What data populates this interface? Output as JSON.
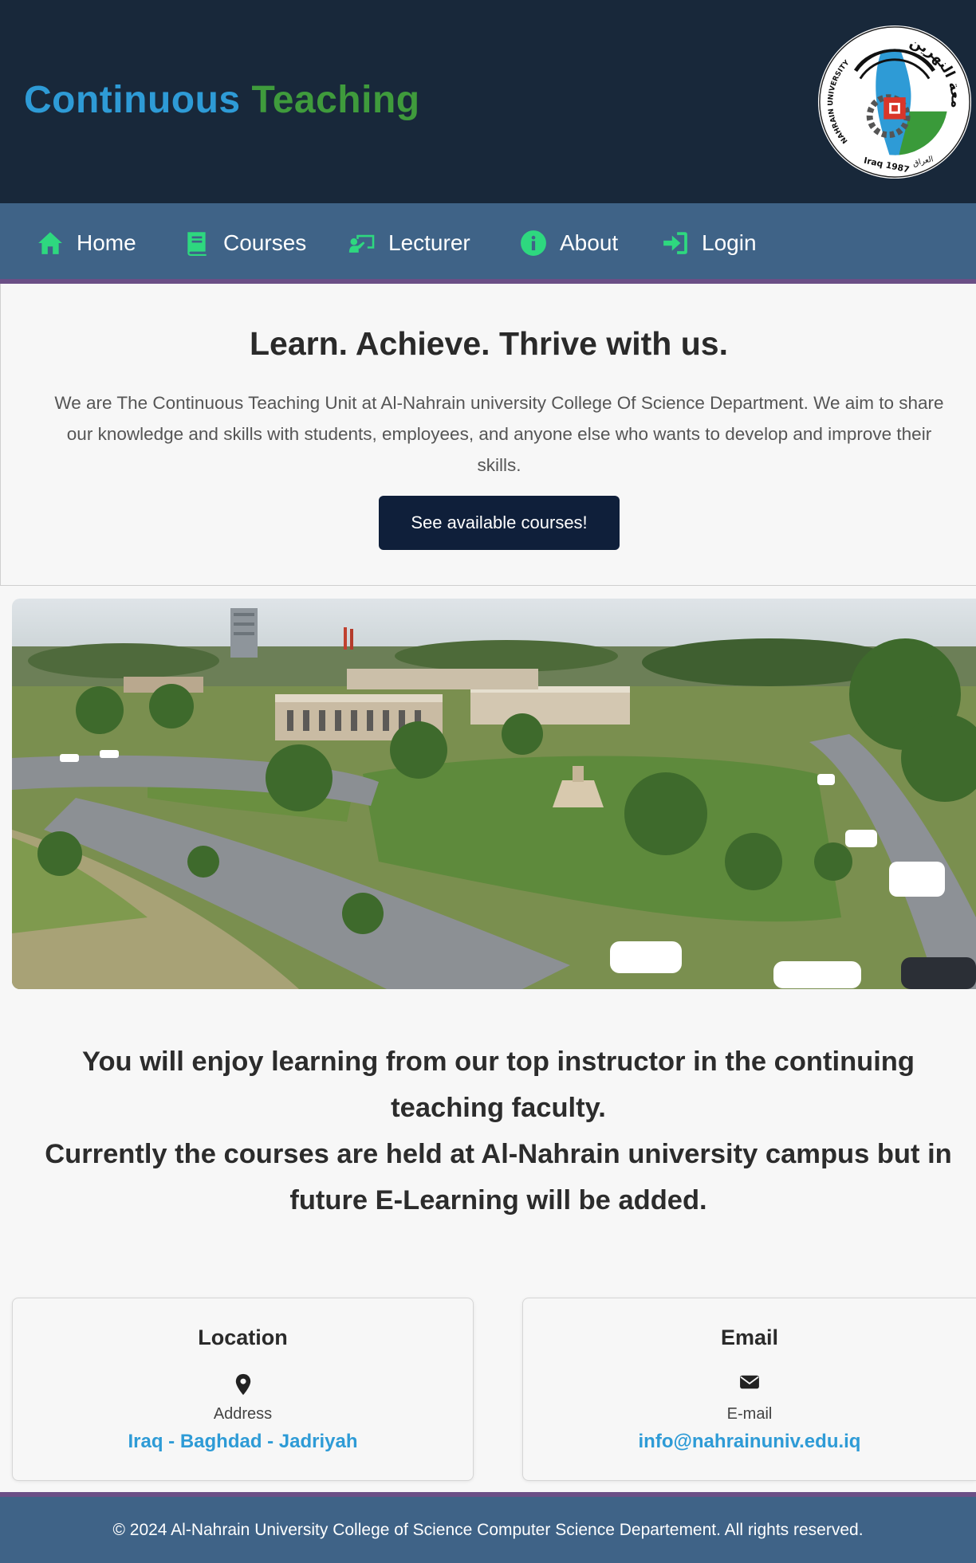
{
  "brand": {
    "word1": "Continuous",
    "word2": "Teaching",
    "colors": {
      "word1": "#2e9bd6",
      "word2": "#3f9b3c"
    }
  },
  "logo": {
    "text_top": "NAHRAIN UNIVERSITY",
    "text_arabic": "جامعة النهرين",
    "text_bottom_left": "Iraq 1987",
    "text_bottom_right": "العراق"
  },
  "nav": {
    "items": [
      {
        "label": "Home",
        "icon": "home-icon"
      },
      {
        "label": "Courses",
        "icon": "book-icon"
      },
      {
        "label": "Lecturer",
        "icon": "lecturer-icon"
      },
      {
        "label": "About",
        "icon": "info-icon"
      },
      {
        "label": "Login",
        "icon": "login-icon"
      }
    ],
    "icon_color": "#2ed87f",
    "background": "#3f6387"
  },
  "hero": {
    "heading": "Learn. Achieve. Thrive with us.",
    "description": "We are The Continuous Teaching Unit at Al-Nahrain university College Of Science Department. We aim to share our knowledge and skills with students, employees, and anyone else who wants to develop and improve their skills.",
    "cta_label": "See available courses!"
  },
  "info": {
    "line1": "You will enjoy learning from our top instructor in the continuing teaching faculty.",
    "line2": "Currently the courses are held at Al-Nahrain university campus but in future E-Learning will be added."
  },
  "cards": {
    "location": {
      "title": "Location",
      "icon": "map-pin-icon",
      "label": "Address",
      "value": "Iraq - Baghdad - Jadriyah"
    },
    "email": {
      "title": "Email",
      "icon": "envelope-icon",
      "label": "E-mail",
      "value": "info@nahrainuniv.edu.iq"
    }
  },
  "footer": {
    "text": "© 2024 Al-Nahrain University College of Science Computer Science Departement. All rights reserved."
  }
}
